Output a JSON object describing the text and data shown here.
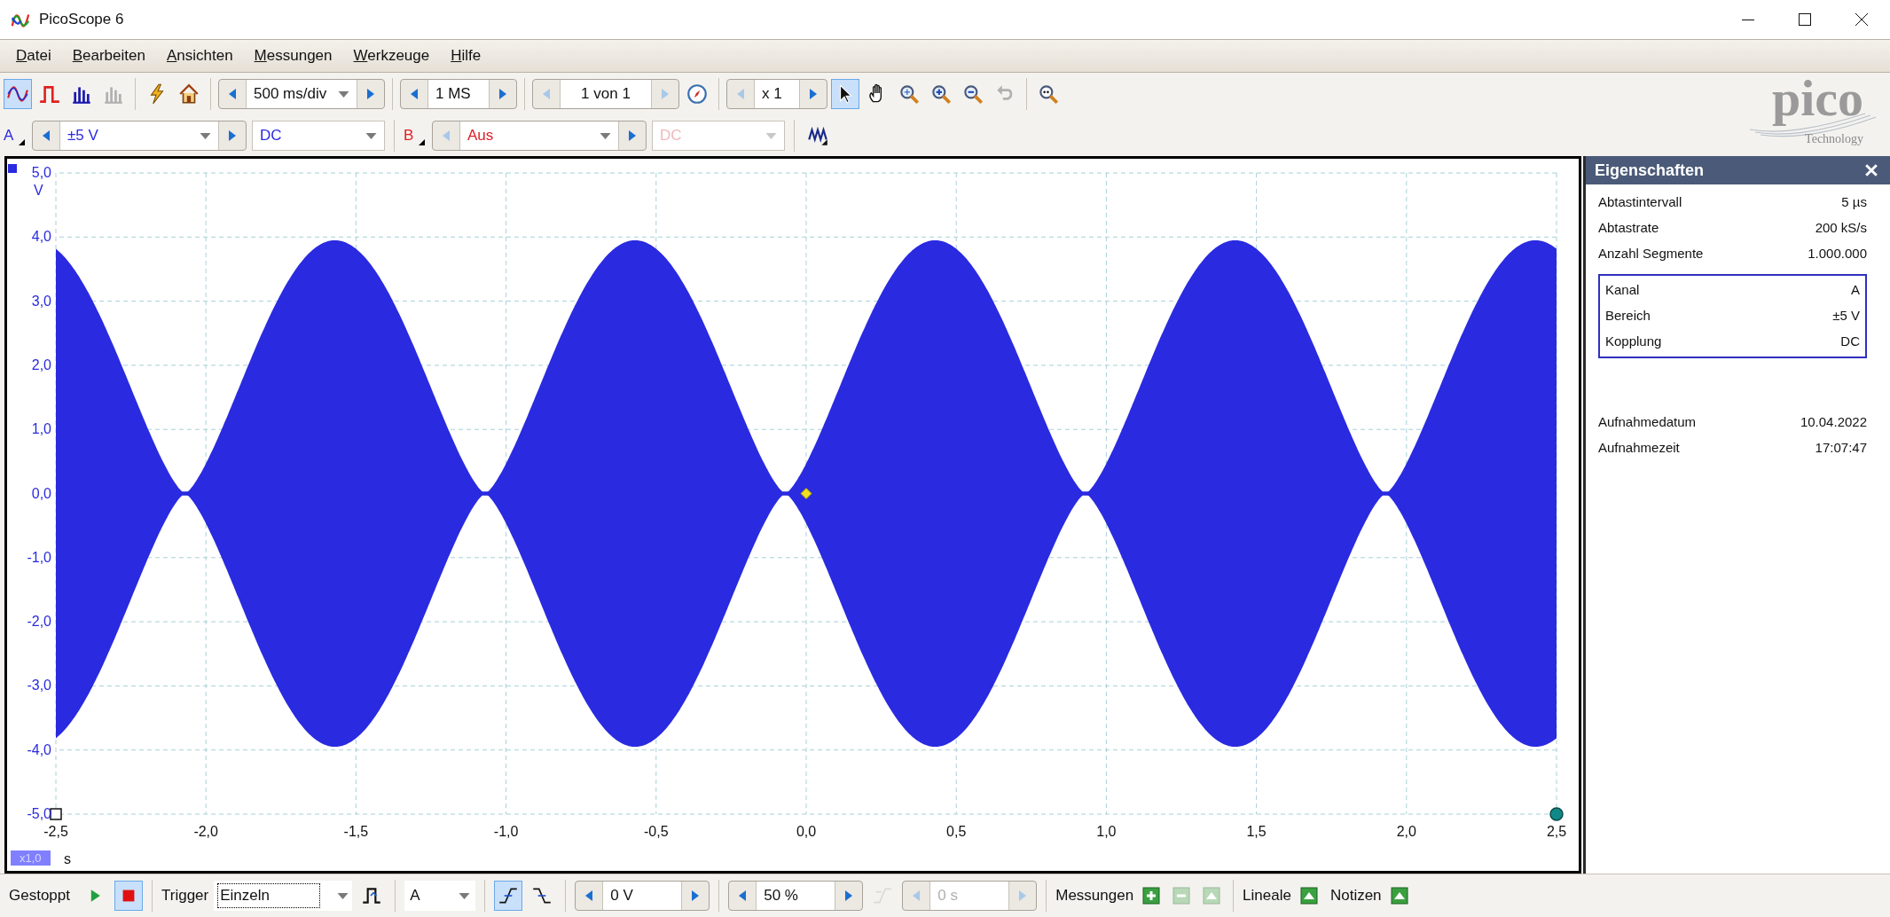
{
  "window": {
    "title": "PicoScope 6"
  },
  "menu": [
    "Datei",
    "Bearbeiten",
    "Ansichten",
    "Messungen",
    "Werkzeuge",
    "Hilfe"
  ],
  "toolbar": {
    "view_modes": [
      {
        "kind": "wave",
        "selected": true,
        "disabled": false
      },
      {
        "kind": "pulse",
        "selected": false,
        "disabled": false
      },
      {
        "kind": "bars",
        "selected": false,
        "disabled": false
      },
      {
        "kind": "bars",
        "selected": false,
        "disabled": true
      }
    ],
    "actions": [
      {
        "kind": "lightning"
      },
      {
        "kind": "home"
      }
    ],
    "timebase": {
      "value": "500 ms/div"
    },
    "samples": {
      "value": "1 MS"
    },
    "buffer": {
      "value": "1 von 1",
      "arrows_disabled": true
    },
    "zoom": {
      "value": "x 1"
    },
    "logo": {
      "name": "pico",
      "tagline": "Technology"
    },
    "tools": [
      {
        "kind": "pointer",
        "selected": true,
        "disabled": false
      },
      {
        "kind": "hand",
        "selected": false,
        "disabled": false
      },
      {
        "kind": "zoom-fit",
        "selected": false,
        "disabled": false
      },
      {
        "kind": "zoom-in",
        "selected": false,
        "disabled": false
      },
      {
        "kind": "zoom-out",
        "selected": false,
        "disabled": false
      },
      {
        "kind": "undo",
        "selected": false,
        "disabled": true
      },
      {
        "kind": "zoom-100",
        "selected": false,
        "disabled": false
      }
    ]
  },
  "channels": [
    {
      "label": "A",
      "color": "#2a2ae0",
      "range": "±5 V",
      "coupling": "DC",
      "enabled": true
    },
    {
      "label": "B",
      "color": "#e0202a",
      "range": "Aus",
      "coupling": "DC",
      "enabled": false
    }
  ],
  "plot": {
    "y_unit": "V",
    "y_ticks": [
      "5,0",
      "4,0",
      "3,0",
      "2,0",
      "1,0",
      "0,0",
      "-1,0",
      "-2,0",
      "-3,0",
      "-4,0",
      "-5,0"
    ],
    "x_unit": "s",
    "x_ticks": [
      "-2,5",
      "-2,0",
      "-1,5",
      "-1,0",
      "-0,5",
      "0,0",
      "0,5",
      "1,0",
      "1,5",
      "2,0",
      "2,5"
    ],
    "zoom_badge": "x1,0"
  },
  "properties": {
    "title": "Eigenschaften",
    "rows": [
      {
        "label": "Abtastintervall",
        "value": "5 µs"
      },
      {
        "label": "Abtastrate",
        "value": "200 kS/s"
      },
      {
        "label": "Anzahl Segmente",
        "value": "1.000.000"
      }
    ],
    "channel_rows": [
      {
        "label": "Kanal",
        "value": "A"
      },
      {
        "label": "Bereich",
        "value": "±5 V"
      },
      {
        "label": "Kopplung",
        "value": "DC"
      }
    ],
    "capture_rows": [
      {
        "label": "Aufnahmedatum",
        "value": "10.04.2022"
      },
      {
        "label": "Aufnahmezeit",
        "value": "17:07:47"
      }
    ]
  },
  "status_bar": {
    "state": "Gestoppt",
    "running": false,
    "trigger_label": "Trigger",
    "trigger_mode": "Einzeln",
    "trigger_source": "A",
    "edges": [
      {
        "kind": "rising",
        "selected": true
      },
      {
        "kind": "falling",
        "selected": false
      }
    ],
    "threshold": "0 V",
    "pretrigger": "50 %",
    "delay": {
      "value": "0 s",
      "disabled": true
    },
    "measurements_label": "Messungen",
    "rulers_label": "Lineale",
    "notes_label": "Notizen"
  }
}
